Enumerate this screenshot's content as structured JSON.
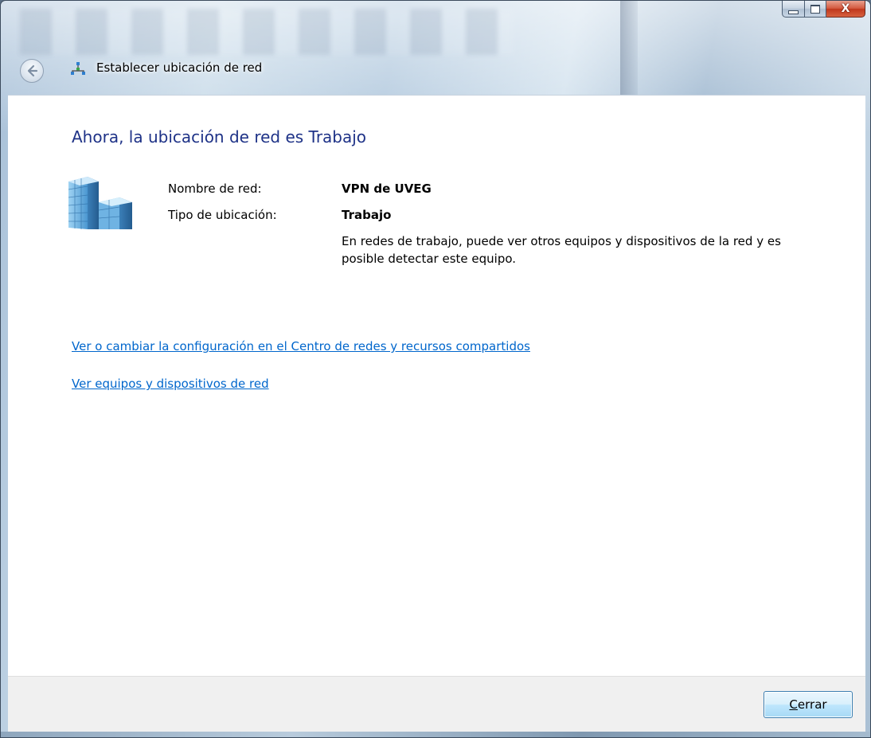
{
  "window": {
    "title": "Establecer ubicación de red"
  },
  "caption": {
    "close_glyph": "X"
  },
  "main": {
    "heading": "Ahora, la ubicación de red es Trabajo",
    "network_name_label": "Nombre de red:",
    "network_name_value": "VPN de UVEG",
    "location_type_label": "Tipo de ubicación:",
    "location_type_value": "Trabajo",
    "location_description": "En redes de trabajo, puede ver otros equipos y dispositivos de la red y es posible detectar este equipo.",
    "links": [
      "Ver o cambiar la configuración en el Centro de redes y recursos compartidos",
      "Ver equipos y dispositivos de red"
    ]
  },
  "footer": {
    "close_accel": "C",
    "close_rest": "errar"
  },
  "colors": {
    "heading": "#1e3287",
    "link": "#0066cc",
    "footer_bg": "#f0f0f0"
  },
  "icons": [
    "back-arrow-icon",
    "network-icon",
    "building-icon",
    "minimize-icon",
    "maximize-icon",
    "close-icon"
  ]
}
